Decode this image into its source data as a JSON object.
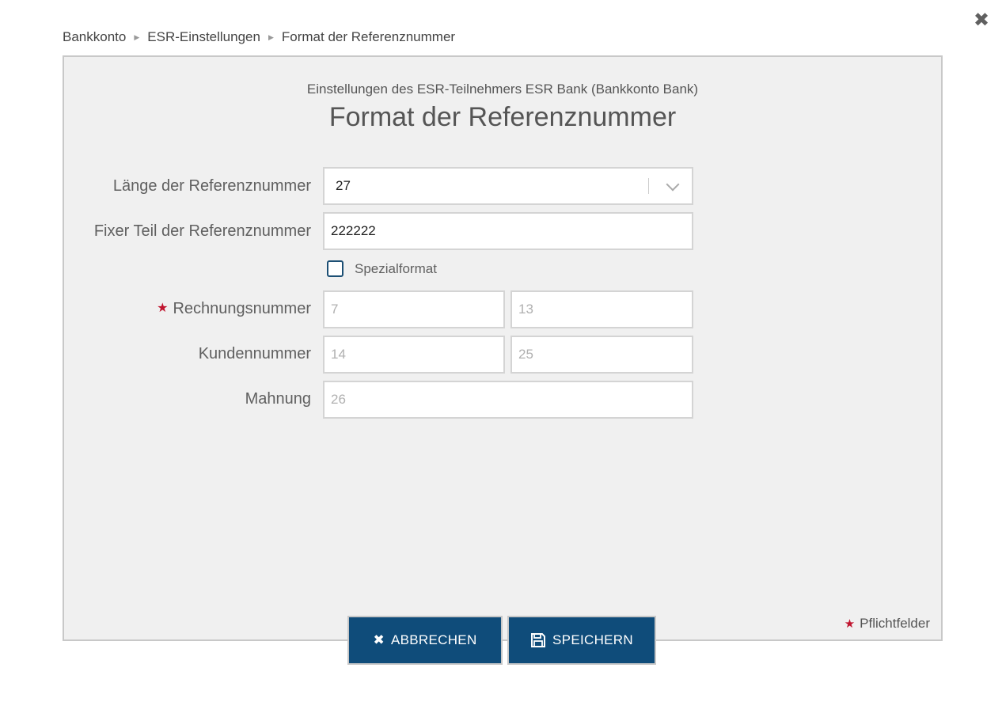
{
  "breadcrumb": {
    "items": [
      "Bankkonto",
      "ESR-Einstellungen",
      "Format der Referenznummer"
    ]
  },
  "header": {
    "subtitle": "Einstellungen des ESR-Teilnehmers ESR Bank (Bankkonto Bank)",
    "title": "Format der Referenznummer"
  },
  "form": {
    "length_label": "Länge der Referenznummer",
    "length_value": "27",
    "fixed_label": "Fixer Teil der Referenznummer",
    "fixed_value": "222222",
    "special_format_label": "Spezialformat",
    "special_format_checked": false,
    "invoice_label": "Rechnungsnummer",
    "invoice_from": "7",
    "invoice_to": "13",
    "customer_label": "Kundennummer",
    "customer_from": "14",
    "customer_to": "25",
    "reminder_label": "Mahnung",
    "reminder_value": "26"
  },
  "footer": {
    "required_note": "Pflichtfelder",
    "cancel_label": "ABBRECHEN",
    "save_label": "SPEICHERN"
  },
  "icons": {
    "close": "close-icon",
    "cancel": "close-icon",
    "save": "save-icon",
    "dropdown": "chevron-down-icon"
  },
  "colors": {
    "primary_button": "#0f4c7a",
    "required_star": "#c0152f",
    "panel_bg": "#f0f0f0"
  }
}
